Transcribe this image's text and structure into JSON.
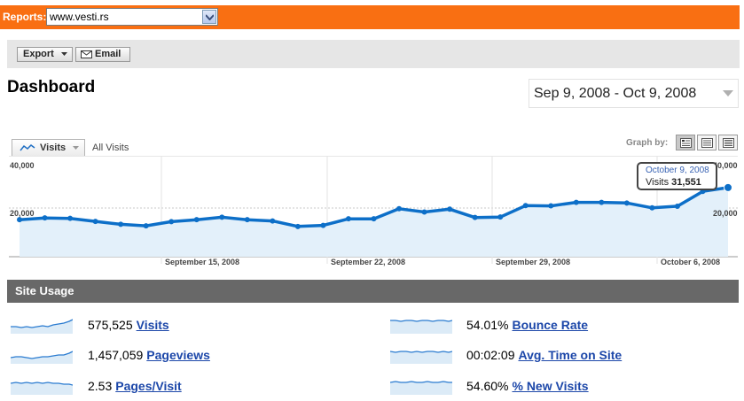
{
  "reports": {
    "label": "Reports:",
    "site": "www.vesti.rs"
  },
  "toolbar": {
    "export_label": "Export",
    "email_label": "Email"
  },
  "page_title": "Dashboard",
  "date_range": "Sep 9, 2008 - Oct 9, 2008",
  "graph_controls": {
    "metric_tab": "Visits",
    "segment": "All Visits",
    "graph_by": "Graph by:"
  },
  "chart_data": {
    "type": "line",
    "series": [
      {
        "name": "Visits",
        "values": [
          16900,
          17700,
          17500,
          16100,
          14800,
          14100,
          16000,
          16900,
          18000,
          16900,
          16300,
          13800,
          14300,
          17300,
          17300,
          21900,
          20400,
          21700,
          17900,
          18100,
          23300,
          23200,
          24800,
          24800,
          24500,
          22300,
          23000,
          29800,
          31551
        ]
      }
    ],
    "x_ticks": [
      "September 15, 2008",
      "September 22, 2008",
      "September 29, 2008",
      "October 6, 2008"
    ],
    "y_ticks_left": [
      "40,000",
      "20,000"
    ],
    "y_ticks_right": [
      "40,000",
      "20,000"
    ],
    "ylim": [
      0,
      42000
    ],
    "line_color": "#0d6fc8",
    "fill_color": "#e3f0fa"
  },
  "tooltip": {
    "date": "October 9, 2008",
    "label": "Visits",
    "value": "31,551"
  },
  "site_usage": {
    "title": "Site Usage",
    "metrics": [
      {
        "value": "575,525",
        "label": "Visits"
      },
      {
        "value": "1,457,059",
        "label": "Pageviews"
      },
      {
        "value": "2.53",
        "label": "Pages/Visit"
      },
      {
        "value": "54.01%",
        "label": "Bounce Rate"
      },
      {
        "value": "00:02:09",
        "label": "Avg. Time on Site"
      },
      {
        "value": "54.60%",
        "label": "% New Visits"
      }
    ]
  }
}
